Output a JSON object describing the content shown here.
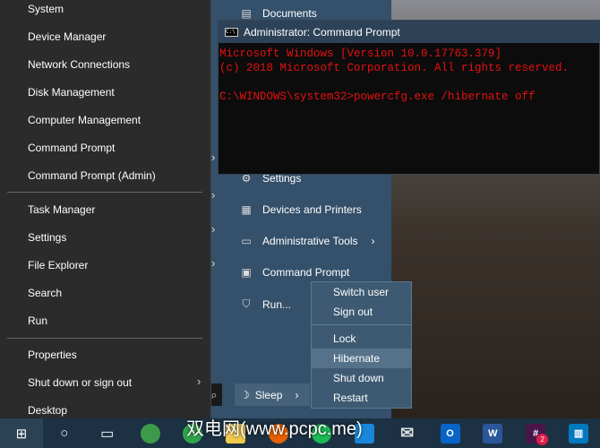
{
  "winx_menu": {
    "items": [
      {
        "label": "System"
      },
      {
        "label": "Device Manager"
      },
      {
        "label": "Network Connections"
      },
      {
        "label": "Disk Management"
      },
      {
        "label": "Computer Management"
      },
      {
        "label": "Command Prompt"
      },
      {
        "label": "Command Prompt (Admin)"
      },
      {
        "label": "Task Manager"
      },
      {
        "label": "Settings"
      },
      {
        "label": "File Explorer"
      },
      {
        "label": "Search"
      },
      {
        "label": "Run"
      },
      {
        "label": "Properties"
      },
      {
        "label": "Shut down or sign out"
      },
      {
        "label": "Desktop"
      }
    ]
  },
  "start_menu": {
    "items": [
      {
        "label": "Documents"
      },
      {
        "label": "Settings"
      },
      {
        "label": "Devices and Printers"
      },
      {
        "label": "Administrative Tools"
      },
      {
        "label": "Command Prompt"
      },
      {
        "label": "Run..."
      }
    ],
    "sleep_label": "Sleep"
  },
  "cmd": {
    "title": "Administrator: Command Prompt",
    "lines": [
      "Microsoft Windows [Version 10.0.17763.379]",
      "(c) 2018 Microsoft Corporation. All rights reserved.",
      "",
      "C:\\WINDOWS\\system32>powercfg.exe /hibernate off"
    ]
  },
  "power_menu": {
    "items": [
      {
        "label": "Switch user"
      },
      {
        "label": "Sign out"
      },
      {
        "label": "Lock"
      },
      {
        "label": "Hibernate"
      },
      {
        "label": "Shut down"
      },
      {
        "label": "Restart"
      }
    ],
    "highlighted": "Hibernate"
  },
  "taskbar": {
    "slack_badge": "2",
    "outlook_letter": "O",
    "word_letter": "W"
  },
  "watermark": "双电网(www.pcpc.me)"
}
